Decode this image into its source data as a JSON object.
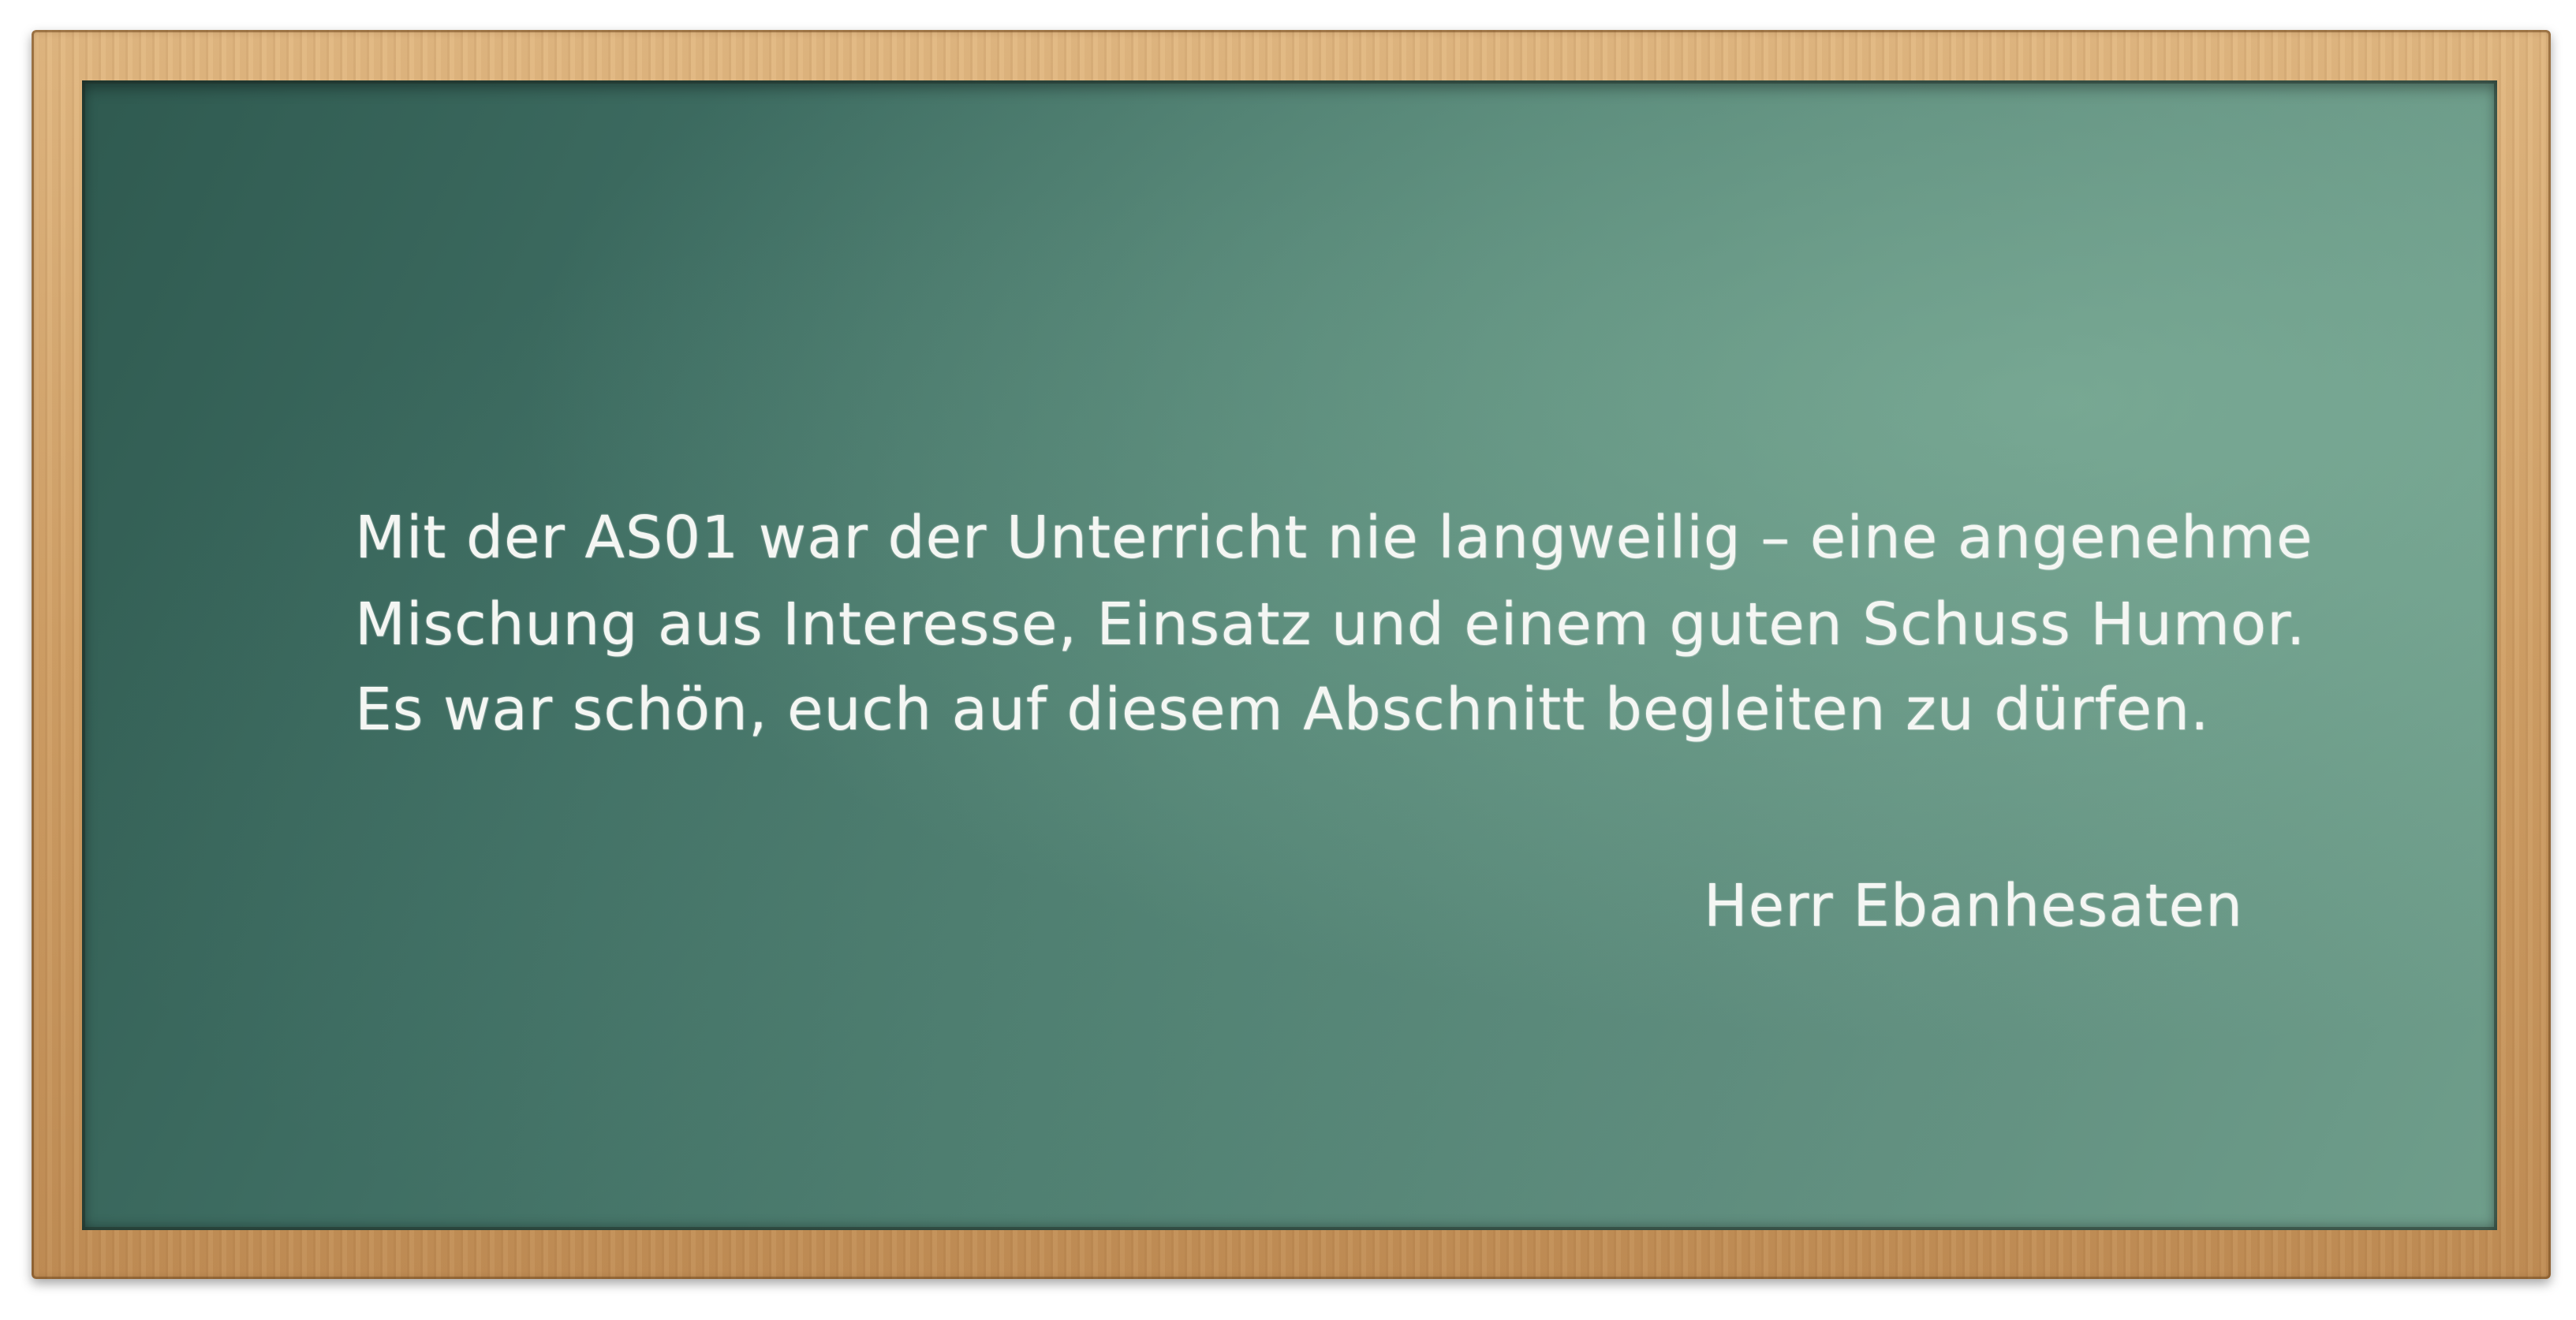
{
  "board": {
    "quote": {
      "line1": "Mit der AS01 war der Unterricht nie langweilig – eine angenehme",
      "line2": "Mischung aus Interesse, Einsatz und einem guten Schuss Humor.",
      "line3": "Es war schön, euch auf diesem Abschnitt begleiten zu dürfen."
    },
    "signature": "Herr Ebanhesaten"
  },
  "colors": {
    "frame": "#cf9f66",
    "board": "#4f7f71",
    "chalk": "#f4f6f3",
    "background": "#ffffff"
  }
}
